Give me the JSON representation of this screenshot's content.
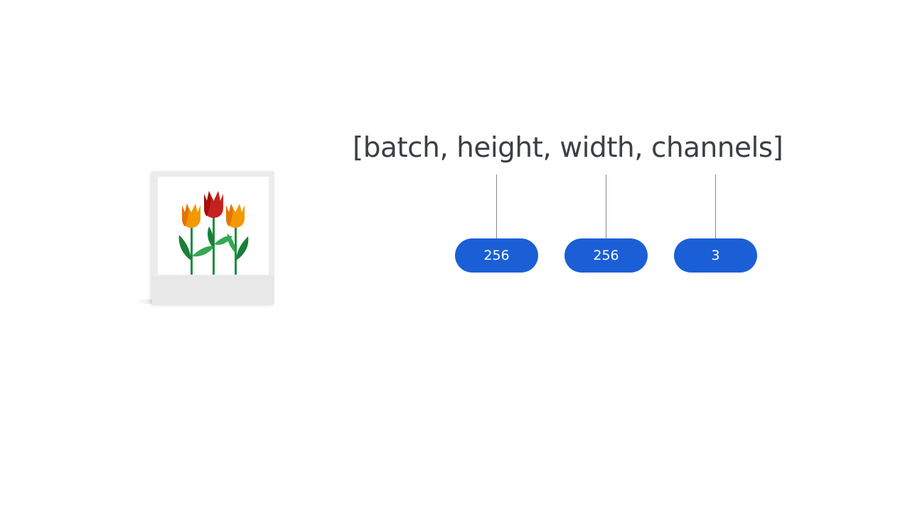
{
  "shape_label": "[batch, height, width, channels]",
  "dimensions": [
    {
      "value": "256"
    },
    {
      "value": "256"
    },
    {
      "value": "3"
    }
  ],
  "image_icon": "tulips-photo-icon",
  "colors": {
    "pill": "#1a5fd6",
    "text": "#3c4043",
    "connector": "#80868b",
    "tulip_orange": "#f29900",
    "tulip_red": "#c5221f",
    "stem_green": "#1e8e3e"
  }
}
